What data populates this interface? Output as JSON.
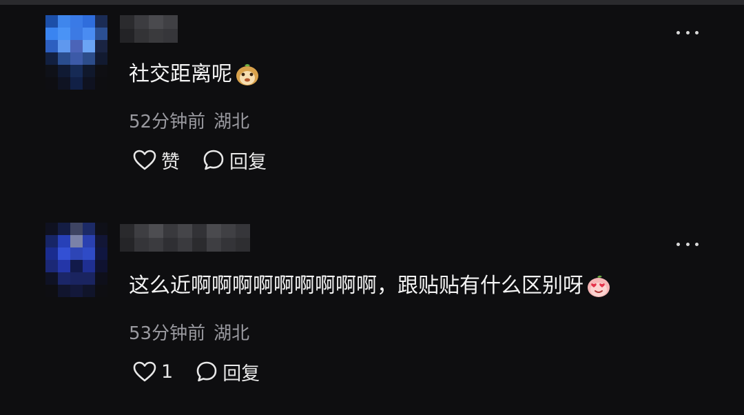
{
  "comments": [
    {
      "text": "社交距离呢",
      "emoji": "monkey-face-emoji",
      "time": "52分钟前",
      "location": "湖北",
      "like_label": "赞",
      "reply_label": "回复"
    },
    {
      "text": "这么近啊啊啊啊啊啊啊啊啊，跟贴贴有什么区别呀",
      "emoji": "heart-eyes-peach-emoji",
      "time": "53分钟前",
      "location": "湖北",
      "like_label": "1",
      "reply_label": "回复"
    }
  ],
  "colors": {
    "background": "#0e0e10",
    "meta_text": "#9a9aa0",
    "avatar_blue": "#3d7bf0"
  }
}
